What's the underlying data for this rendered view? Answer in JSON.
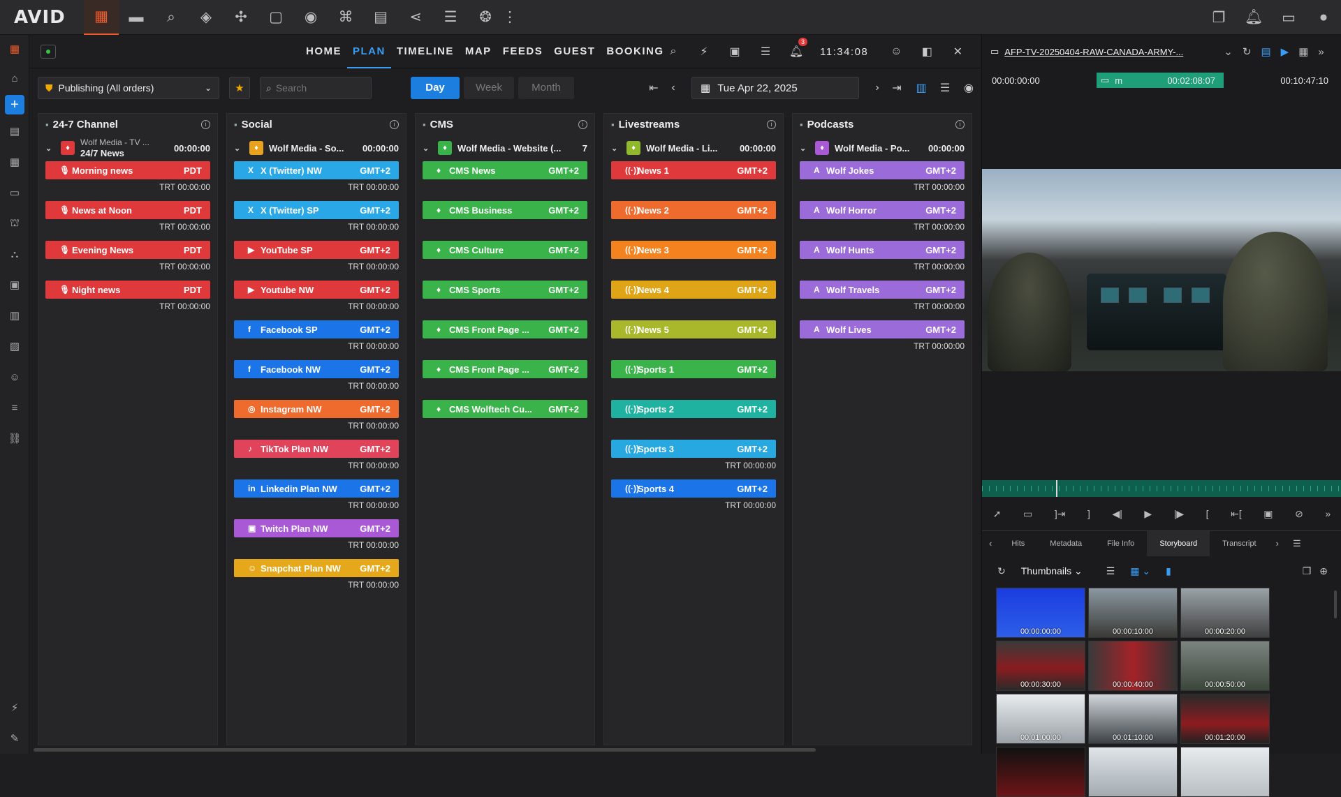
{
  "app": {
    "logo": "AVID"
  },
  "topbar": {
    "icons": [
      "plan-icon",
      "folder-icon",
      "search-icon",
      "tools-icon",
      "atom-icon",
      "square-icon",
      "record-icon",
      "bookmark-icon",
      "notes-icon",
      "share-icon",
      "sequence-icon",
      "settings-wheel-icon",
      "more-icon"
    ],
    "right_icons": [
      "window-icon",
      "bell-icon",
      "inbox-icon",
      "user-icon"
    ]
  },
  "nav": {
    "links": [
      "HOME",
      "PLAN",
      "TIMELINE",
      "MAP",
      "FEEDS",
      "GUEST",
      "BOOKING"
    ],
    "active": "PLAN",
    "notification_count": "3",
    "clock": "11:34:08"
  },
  "toolbar": {
    "dropdown": "Publishing (All orders)",
    "search_placeholder": "Search",
    "day": "Day",
    "week": "Week",
    "month": "Month",
    "date": "Tue Apr 22, 2025"
  },
  "columns": [
    {
      "title": "24-7 Channel",
      "group": {
        "name": "Wolf Media - TV ...",
        "sub": "24/7 News",
        "time": "00:00:00",
        "color": "#e0393c"
      },
      "items": [
        {
          "name": "Morning news",
          "tz": "PDT",
          "trt": "TRT 00:00:00",
          "color": "#e0393c",
          "icon": "🎙"
        },
        {
          "name": "News at Noon",
          "tz": "PDT",
          "trt": "TRT 00:00:00",
          "color": "#e0393c",
          "icon": "🎙"
        },
        {
          "name": "Evening News",
          "tz": "PDT",
          "trt": "TRT 00:00:00",
          "color": "#e0393c",
          "icon": "🎙"
        },
        {
          "name": "Night news",
          "tz": "PDT",
          "trt": "TRT 00:00:00",
          "color": "#e0393c",
          "icon": "🎙"
        }
      ]
    },
    {
      "title": "Social",
      "group": {
        "name": "Wolf Media - So...",
        "time": "00:00:00",
        "color": "#e8a21b"
      },
      "items": [
        {
          "name": "X (Twitter) NW",
          "tz": "GMT+2",
          "trt": "TRT 00:00:00",
          "color": "#2aa7e6",
          "icon": "X"
        },
        {
          "name": "X (Twitter) SP",
          "tz": "GMT+2",
          "trt": "TRT 00:00:00",
          "color": "#2aa7e6",
          "icon": "X"
        },
        {
          "name": "YouTube SP",
          "tz": "GMT+2",
          "trt": "TRT 00:00:00",
          "color": "#e0393c",
          "icon": "▶"
        },
        {
          "name": "Youtube NW",
          "tz": "GMT+2",
          "trt": "TRT 00:00:00",
          "color": "#e0393c",
          "icon": "▶"
        },
        {
          "name": "Facebook SP",
          "tz": "GMT+2",
          "trt": "TRT 00:00:00",
          "color": "#1b74e8",
          "icon": "f"
        },
        {
          "name": "Facebook NW",
          "tz": "GMT+2",
          "trt": "TRT 00:00:00",
          "color": "#1b74e8",
          "icon": "f"
        },
        {
          "name": "Instagram NW",
          "tz": "GMT+2",
          "trt": "TRT 00:00:00",
          "color": "#ef6a2d",
          "icon": "◎"
        },
        {
          "name": "TikTok Plan NW",
          "tz": "GMT+2",
          "trt": "TRT 00:00:00",
          "color": "#e0435a",
          "icon": "♪"
        },
        {
          "name": "Linkedin Plan NW",
          "tz": "GMT+2",
          "trt": "TRT 00:00:00",
          "color": "#1b74e8",
          "icon": "in"
        },
        {
          "name": "Twitch Plan NW",
          "tz": "GMT+2",
          "trt": "TRT 00:00:00",
          "color": "#a959d6",
          "icon": "▣"
        },
        {
          "name": "Snapchat Plan NW",
          "tz": "GMT+2",
          "trt": "TRT 00:00:00",
          "color": "#e6a81b",
          "icon": "☺"
        }
      ]
    },
    {
      "title": "CMS",
      "group": {
        "name": "Wolf Media - Website (...",
        "time": "7",
        "color": "#3ab34a"
      },
      "items": [
        {
          "name": "CMS News",
          "tz": "GMT+2",
          "trt": "",
          "color": "#3ab34a",
          "icon": "♦"
        },
        {
          "name": "CMS Business",
          "tz": "GMT+2",
          "trt": "",
          "color": "#3ab34a",
          "icon": "♦"
        },
        {
          "name": "CMS Culture",
          "tz": "GMT+2",
          "trt": "",
          "color": "#3ab34a",
          "icon": "♦"
        },
        {
          "name": "CMS Sports",
          "tz": "GMT+2",
          "trt": "",
          "color": "#3ab34a",
          "icon": "♦"
        },
        {
          "name": "CMS Front Page ...",
          "tz": "GMT+2",
          "trt": "",
          "color": "#3ab34a",
          "icon": "♦"
        },
        {
          "name": "CMS Front Page ...",
          "tz": "GMT+2",
          "trt": "",
          "color": "#3ab34a",
          "icon": "♦"
        },
        {
          "name": "CMS Wolftech Cu...",
          "tz": "GMT+2",
          "trt": "",
          "color": "#3ab34a",
          "icon": "♦"
        }
      ]
    },
    {
      "title": "Livestreams",
      "group": {
        "name": "Wolf Media - Li...",
        "time": "00:00:00",
        "color": "#8fb82a"
      },
      "items": [
        {
          "name": "News 1",
          "tz": "GMT+2",
          "trt": "",
          "color": "#e0393c",
          "icon": "((·))"
        },
        {
          "name": "News 2",
          "tz": "GMT+2",
          "trt": "",
          "color": "#ef6a2d",
          "icon": "((·))"
        },
        {
          "name": "News 3",
          "tz": "GMT+2",
          "trt": "",
          "color": "#f4821f",
          "icon": "((·))"
        },
        {
          "name": "News 4",
          "tz": "GMT+2",
          "trt": "",
          "color": "#e0a517",
          "icon": "((·))"
        },
        {
          "name": "News 5",
          "tz": "GMT+2",
          "trt": "",
          "color": "#a9b82a",
          "icon": "((·))"
        },
        {
          "name": "Sports 1",
          "tz": "GMT+2",
          "trt": "",
          "color": "#3ab34a",
          "icon": "((·))"
        },
        {
          "name": "Sports 2",
          "tz": "GMT+2",
          "trt": "",
          "color": "#1fb2a0",
          "icon": "((·))"
        },
        {
          "name": "Sports 3",
          "tz": "GMT+2",
          "trt": "TRT 00:00:00",
          "color": "#27a8e0",
          "icon": "((·))"
        },
        {
          "name": "Sports 4",
          "tz": "GMT+2",
          "trt": "TRT 00:00:00",
          "color": "#1b74e8",
          "icon": "((·))"
        }
      ]
    },
    {
      "title": "Podcasts",
      "group": {
        "name": "Wolf Media - Po...",
        "time": "00:00:00",
        "color": "#a959d6"
      },
      "items": [
        {
          "name": "Wolf Jokes",
          "tz": "GMT+2",
          "trt": "TRT 00:00:00",
          "color": "#9b6bd9",
          "icon": "A"
        },
        {
          "name": "Wolf Horror",
          "tz": "GMT+2",
          "trt": "TRT 00:00:00",
          "color": "#9b6bd9",
          "icon": "A"
        },
        {
          "name": "Wolf Hunts",
          "tz": "GMT+2",
          "trt": "TRT 00:00:00",
          "color": "#9b6bd9",
          "icon": "A"
        },
        {
          "name": "Wolf Travels",
          "tz": "GMT+2",
          "trt": "TRT 00:00:00",
          "color": "#9b6bd9",
          "icon": "A"
        },
        {
          "name": "Wolf Lives",
          "tz": "GMT+2",
          "trt": "TRT 00:00:00",
          "color": "#9b6bd9",
          "icon": "A"
        }
      ]
    }
  ],
  "player": {
    "clip_name": "AFP-TV-20250404-RAW-CANADA-ARMY-...",
    "tc_in": "00:00:00:00",
    "tc_mode": "m",
    "tc_current": "00:02:08:07",
    "tc_out": "00:10:47:10"
  },
  "panel_tabs": [
    "Hits",
    "Metadata",
    "File Info",
    "Storyboard",
    "Transcript"
  ],
  "active_tab": "Storyboard",
  "storyboard": {
    "view": "Thumbnails",
    "thumbs": [
      "00:00:00:00",
      "00:00:10:00",
      "00:00:20:00",
      "00:00:30:00",
      "00:00:40:00",
      "00:00:50:00",
      "00:01:00:00",
      "00:01:10:00",
      "00:01:20:00",
      "",
      "",
      ""
    ]
  }
}
